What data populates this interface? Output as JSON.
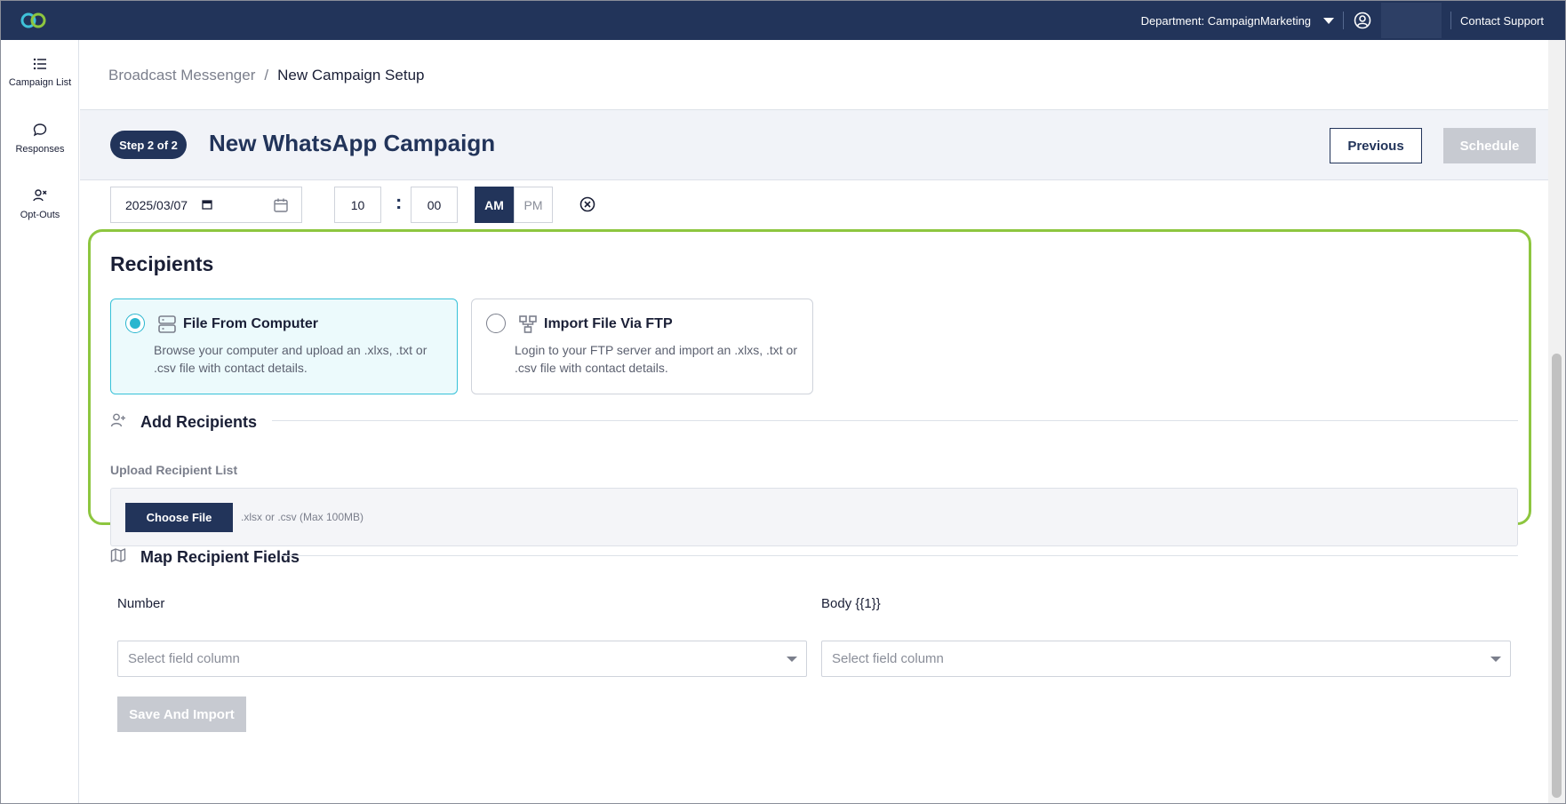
{
  "topbar": {
    "logo_name": "infinity-logo",
    "department": "Department: CampaignMarketing",
    "contact_support": "Contact Support"
  },
  "sidebar": {
    "items": [
      {
        "label": "Campaign List",
        "icon": "list-icon"
      },
      {
        "label": "Responses",
        "icon": "chat-bubble-icon"
      },
      {
        "label": "Opt-Outs",
        "icon": "user-remove-icon"
      }
    ]
  },
  "breadcrumb": {
    "parent": "Broadcast Messenger",
    "separator": "/",
    "current": "New Campaign Setup"
  },
  "header": {
    "step_badge": "Step 2 of 2",
    "title": "New WhatsApp Campaign",
    "previous_label": "Previous",
    "schedule_label": "Schedule"
  },
  "schedule": {
    "date": "2025/03/07",
    "hour": "10",
    "colon": ":",
    "minute": "00",
    "am": "AM",
    "pm": "PM",
    "selected_period": "AM"
  },
  "recipients": {
    "title": "Recipients",
    "options": [
      {
        "title": "File From Computer",
        "description": "Browse your computer and upload an .xlxs, .txt or .csv file with contact details.",
        "selected": true,
        "icon": "server-icon"
      },
      {
        "title": "Import File Via FTP",
        "description": "Login to your FTP server and import an .xlxs, .txt or .csv file with contact details.",
        "selected": false,
        "icon": "network-icon"
      }
    ],
    "add_title": "Add Recipients",
    "upload_label": "Upload Recipient List",
    "choose_file": "Choose File",
    "upload_hint": ".xlsx or .csv (Max 100MB)"
  },
  "mapping": {
    "title": "Map Recipient Fields",
    "fields": [
      {
        "label": "Number",
        "placeholder": "Select field column"
      },
      {
        "label": "Body {{1}}",
        "placeholder": "Select field column"
      }
    ],
    "save_label": "Save And Import"
  },
  "colors": {
    "navy": "#22345a",
    "highlight": "#8dc63f",
    "accent_cyan": "#29b6cf",
    "disabled": "#c7cad1"
  }
}
